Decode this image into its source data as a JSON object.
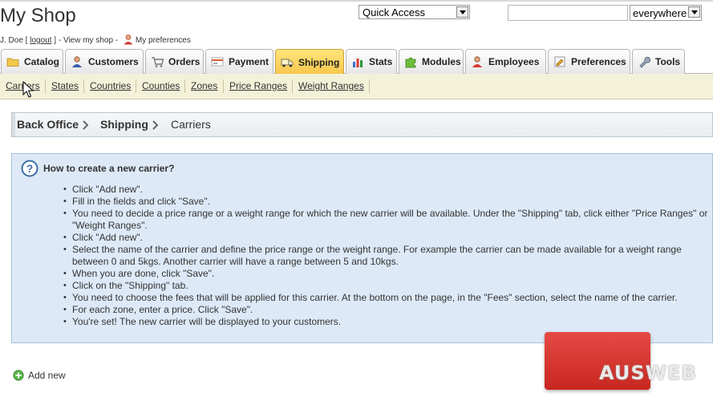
{
  "header": {
    "shop_title": "My Shop",
    "user_prefix": "J. Doe [ ",
    "logout": "logout",
    "user_mid": " ] - ",
    "view_shop": "View my shop",
    "dash": " - ",
    "preferences": "My preferences",
    "quick_access": "Quick Access",
    "search_value": "",
    "search_scope": "everywhere"
  },
  "tabs": [
    {
      "label": "Catalog",
      "icon": "folder-icon"
    },
    {
      "label": "Customers",
      "icon": "customer-icon"
    },
    {
      "label": "Orders",
      "icon": "cart-icon"
    },
    {
      "label": "Payment",
      "icon": "payment-icon"
    },
    {
      "label": "Shipping",
      "icon": "truck-icon",
      "active": true
    },
    {
      "label": "Stats",
      "icon": "chart-icon"
    },
    {
      "label": "Modules",
      "icon": "puzzle-icon"
    },
    {
      "label": "Employees",
      "icon": "employee-icon"
    },
    {
      "label": "Preferences",
      "icon": "preferences-icon"
    },
    {
      "label": "Tools",
      "icon": "wrench-icon"
    }
  ],
  "subnav": [
    "Carriers",
    "States",
    "Countries",
    "Counties",
    "Zones",
    "Price Ranges",
    "Weight Ranges"
  ],
  "breadcrumb": [
    "Back Office",
    "Shipping",
    "Carriers"
  ],
  "help": {
    "title": "How to create a new carrier?",
    "steps": [
      "Click \"Add new\".",
      "Fill in the fields and click \"Save\".",
      "You need to decide a price range or a weight range for which the new carrier will be available. Under the \"Shipping\" tab, click either \"Price Ranges\" or \"Weight Ranges\".",
      "Click \"Add new\".",
      "Select the name of the carrier and define the price range or the weight range. For example the carrier can be made available for a weight range between 0 and 5kgs. Another carrier will have a range between 5 and 10kgs.",
      "When you are done, click \"Save\".",
      "Click on the \"Shipping\" tab.",
      "You need to choose the fees that will be applied for this carrier. At the bottom on the page, in the \"Fees\" section, select the name of the carrier.",
      "For each zone, enter a price. Click \"Save\".",
      "You're set! The new carrier will be displayed to your customers."
    ]
  },
  "actions": {
    "add_new": "Add new"
  },
  "watermark": {
    "text": "AUSWEB"
  },
  "colors": {
    "active_tab": "#f8c64b",
    "subnav_bg": "#f4f1d9",
    "help_bg": "#dde9f7",
    "watermark_red": "#d0302a"
  }
}
